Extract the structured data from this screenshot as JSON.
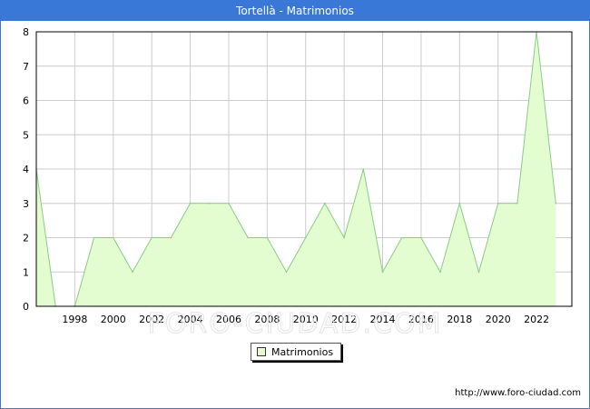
{
  "window": {
    "title": "Tortellà - Matrimonios"
  },
  "legend": {
    "label": "Matrimonios"
  },
  "source": {
    "text": "http://www.foro-ciudad.com"
  },
  "watermark": "FORO-CIUDAD.COM",
  "colors": {
    "title_bg": "#3a78d8",
    "fill": "#e3fdd0",
    "line": "#88cc88",
    "grid": "#cccccc"
  },
  "chart_data": {
    "type": "area",
    "title": "Tortellà - Matrimonios",
    "xlabel": "",
    "ylabel": "",
    "x": [
      1996,
      1997,
      1998,
      1999,
      2000,
      2001,
      2002,
      2003,
      2004,
      2005,
      2006,
      2007,
      2008,
      2009,
      2010,
      2011,
      2012,
      2013,
      2014,
      2015,
      2016,
      2017,
      2018,
      2019,
      2020,
      2021,
      2022,
      2023
    ],
    "series": [
      {
        "name": "Matrimonios",
        "values": [
          4,
          0,
          0,
          2,
          2,
          1,
          2,
          2,
          3,
          3,
          3,
          2,
          2,
          1,
          2,
          3,
          2,
          4,
          1,
          2,
          2,
          1,
          3,
          1,
          3,
          3,
          8,
          3
        ]
      }
    ],
    "xticks": [
      1998,
      2000,
      2002,
      2004,
      2006,
      2008,
      2010,
      2012,
      2014,
      2016,
      2018,
      2020,
      2022
    ],
    "yticks": [
      0,
      1,
      2,
      3,
      4,
      5,
      6,
      7,
      8
    ],
    "xlim": [
      1996,
      2023
    ],
    "ylim": [
      0,
      8
    ],
    "grid": true,
    "legend_position": "bottom-center"
  }
}
